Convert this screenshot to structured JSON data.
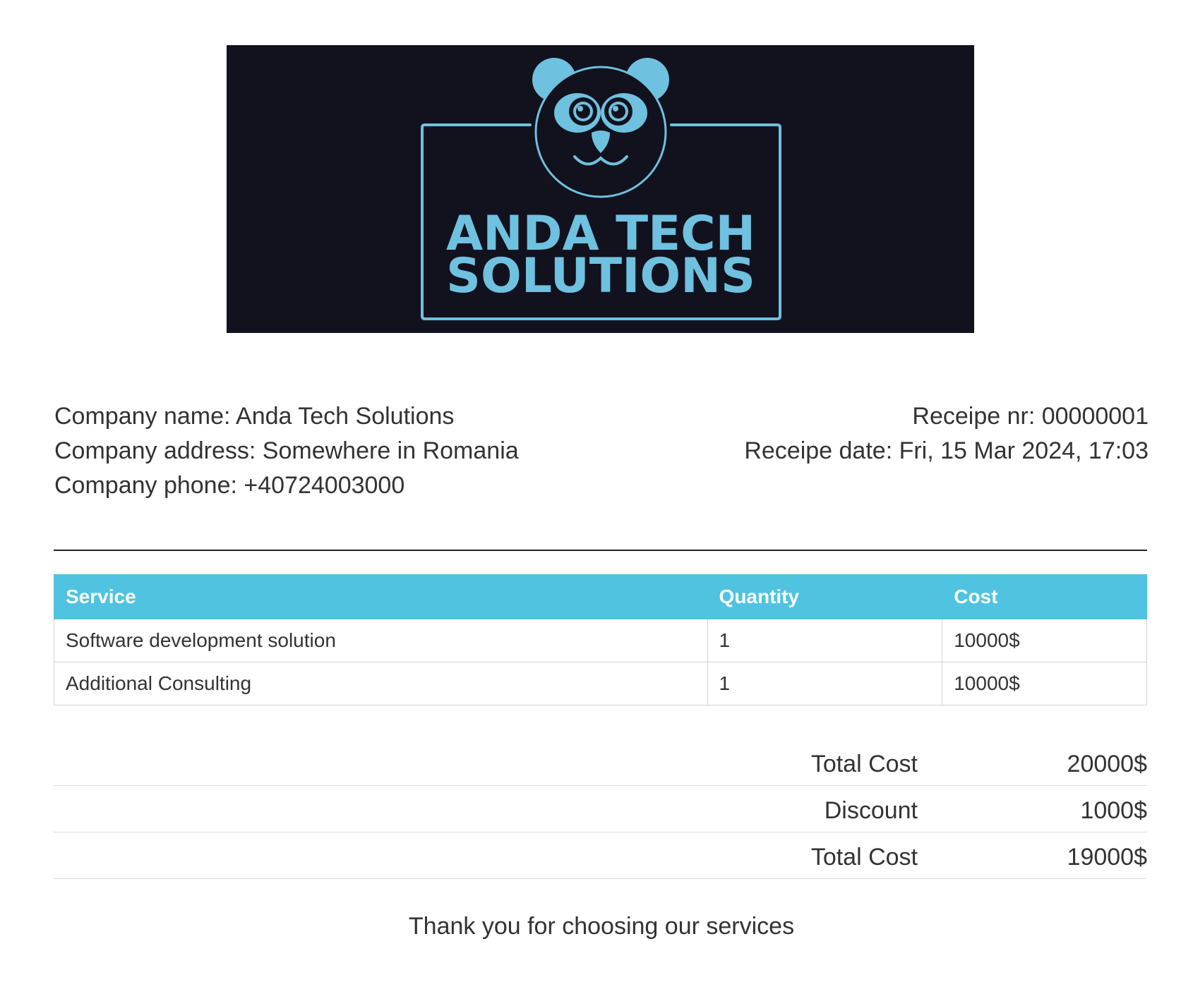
{
  "logo": {
    "line1": "ANDA TECH",
    "line2": "SOLUTIONS",
    "background": "#11121e",
    "accent": "#6ec1df",
    "icon": "panda-icon"
  },
  "company": {
    "name_line": "Company name: Anda Tech Solutions",
    "address_line": "Company address: Somewhere in Romania",
    "phone_line": "Company phone: +40724003000"
  },
  "receipt": {
    "number_line": "Receipe nr: 00000001",
    "date_line": "Receipe date: Fri, 15 Mar 2024, 17:03"
  },
  "table": {
    "header_color": "#4fc3e0",
    "headers": [
      "Service",
      "Quantity",
      "Cost"
    ],
    "rows": [
      {
        "service": "Software development solution",
        "quantity": "1",
        "cost": "10000$"
      },
      {
        "service": "Additional Consulting",
        "quantity": "1",
        "cost": "10000$"
      }
    ]
  },
  "totals": [
    {
      "label": "Total Cost",
      "value": "20000$"
    },
    {
      "label": "Discount",
      "value": "1000$"
    },
    {
      "label": "Total Cost",
      "value": "19000$"
    }
  ],
  "footer": {
    "thanks": "Thank you for choosing our services"
  }
}
